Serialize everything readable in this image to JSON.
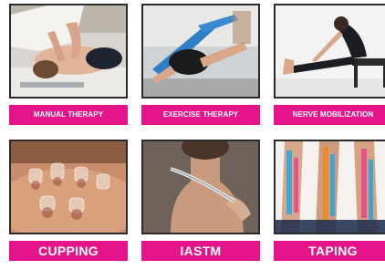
{
  "services": [
    {
      "label": "MANUAL THERAPY",
      "image": "manual-therapy-photo"
    },
    {
      "label": "EXERCISE THERAPY",
      "image": "exercise-therapy-photo"
    },
    {
      "label": "NERVE MOBILIZATION",
      "image": "nerve-mobilization-photo"
    },
    {
      "label": "CUPPING",
      "image": "cupping-photo"
    },
    {
      "label": "IASTM",
      "image": "iastm-photo"
    },
    {
      "label": "TAPING",
      "image": "taping-photo"
    }
  ],
  "colors": {
    "label_background": "#e5148b",
    "label_text": "#ffffff",
    "photo_border": "#2b2b2b"
  }
}
